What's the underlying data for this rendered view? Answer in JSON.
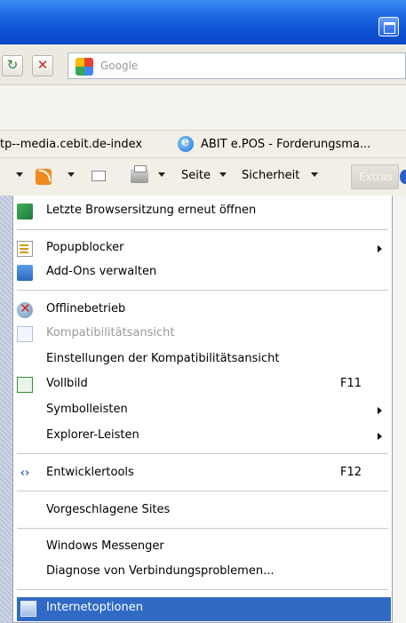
{
  "search": {
    "placeholder": "Google"
  },
  "favorites": {
    "item1": "tp--media.cebit.de-index",
    "item2": "ABIT e.POS - Forderungsma..."
  },
  "commandbar": {
    "page_label": "Seite",
    "safety_label": "Sicherheit",
    "extras_label": "Extras"
  },
  "menu": {
    "items": [
      {
        "label": "Letzte Browsersitzung erneut öffnen",
        "icon": "restore-session-icon"
      },
      {
        "label": "Popupblocker",
        "icon": "popup-blocker-icon",
        "submenu": true
      },
      {
        "label": "Add-Ons verwalten",
        "icon": "addons-icon"
      },
      {
        "label": "Offlinebetrieb",
        "icon": "offline-icon"
      },
      {
        "label": "Kompatibilitätsansicht",
        "icon": "compat-view-icon",
        "disabled": true
      },
      {
        "label": "Einstellungen der Kompatibilitätsansicht"
      },
      {
        "label": "Vollbild",
        "icon": "fullscreen-icon",
        "shortcut": "F11"
      },
      {
        "label": "Symbolleisten",
        "submenu": true
      },
      {
        "label": "Explorer-Leisten",
        "submenu": true
      },
      {
        "label": "Entwicklertools",
        "icon": "devtools-icon",
        "shortcut": "F12"
      },
      {
        "label": "Vorgeschlagene Sites"
      },
      {
        "label": "Windows Messenger"
      },
      {
        "label": "Diagnose von Verbindungsproblemen..."
      },
      {
        "label": "Internetoptionen",
        "icon": "internet-options-icon",
        "selected": true
      }
    ]
  },
  "colors": {
    "titlebar": "#0b4fd0",
    "menu_highlight": "#316ac5",
    "disabled_text": "#9a9a9a"
  }
}
